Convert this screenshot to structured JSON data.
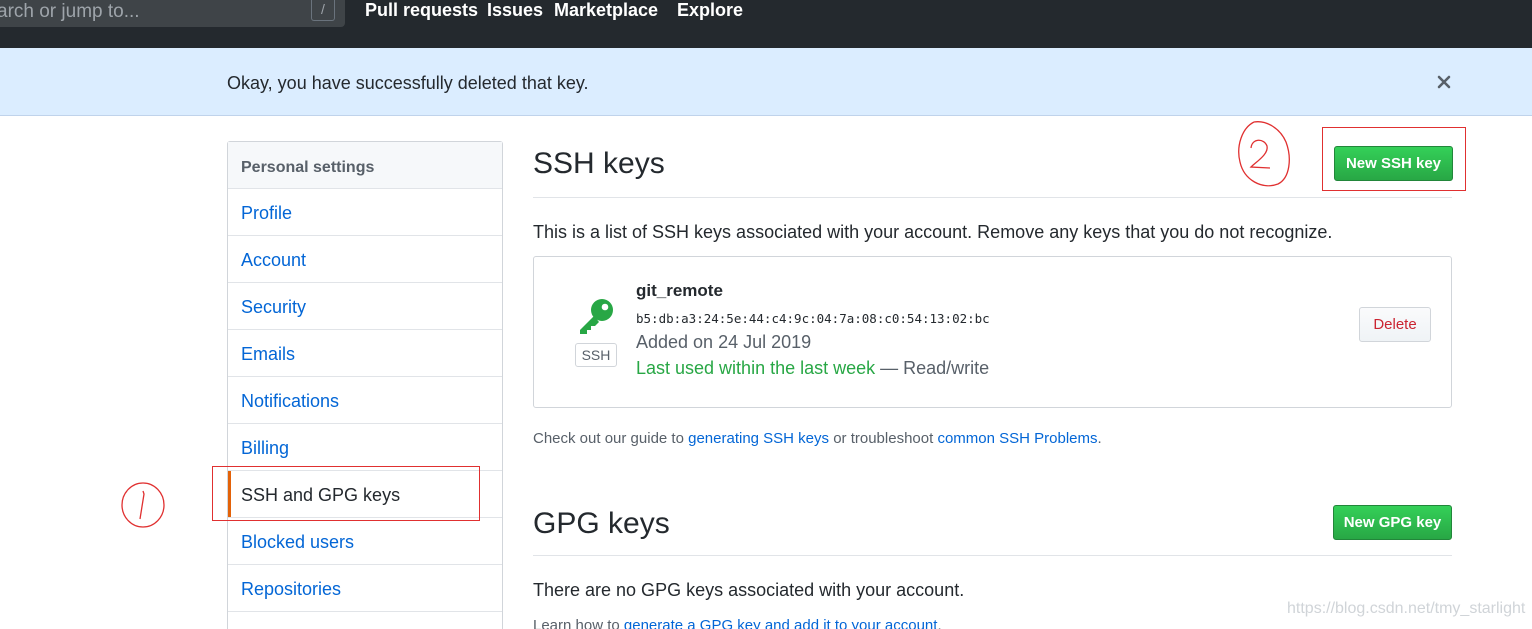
{
  "header": {
    "search_placeholder": "arch or jump to...",
    "search_shortcut": "/",
    "nav": [
      "Pull requests",
      "Issues",
      "Marketplace",
      "Explore"
    ]
  },
  "flash": {
    "message": "Okay, you have successfully deleted that key.",
    "close_icon": "x-icon"
  },
  "sidebar": {
    "heading": "Personal settings",
    "items": [
      {
        "label": "Profile"
      },
      {
        "label": "Account"
      },
      {
        "label": "Security"
      },
      {
        "label": "Emails"
      },
      {
        "label": "Notifications"
      },
      {
        "label": "Billing"
      },
      {
        "label": "SSH and GPG keys",
        "selected": true
      },
      {
        "label": "Blocked users"
      },
      {
        "label": "Repositories"
      }
    ]
  },
  "ssh": {
    "title": "SSH keys",
    "new_button": "New SSH key",
    "description": "This is a list of SSH keys associated with your account. Remove any keys that you do not recognize.",
    "key": {
      "icon": "key-icon",
      "type_label": "SSH",
      "name": "git_remote",
      "fingerprint": "b5:db:a3:24:5e:44:c4:9c:04:7a:08:c0:54:13:02:bc",
      "added": "Added on 24 Jul 2019",
      "last_used": "Last used within the last week",
      "access": " — Read/write",
      "delete_button": "Delete"
    },
    "note_prefix": "Check out our guide to ",
    "note_link1": "generating SSH keys",
    "note_middle": " or troubleshoot ",
    "note_link2": "common SSH Problems",
    "note_suffix": "."
  },
  "gpg": {
    "title": "GPG keys",
    "new_button": "New GPG key",
    "description": "There are no GPG keys associated with your account.",
    "learn_prefix": "Learn how to ",
    "learn_link": "generate a GPG key and add it to your account",
    "learn_suffix": "."
  },
  "annotations": {
    "circle_1": "1",
    "circle_2": "2",
    "color": "#e03030"
  },
  "watermark": "https://blog.csdn.net/tmy_starlight",
  "colors": {
    "header_bg": "#24292e",
    "flash_bg": "#dbedff",
    "link": "#0366d6",
    "green": "#28a745",
    "danger": "#cb2431",
    "selected_bar": "#e36209"
  }
}
